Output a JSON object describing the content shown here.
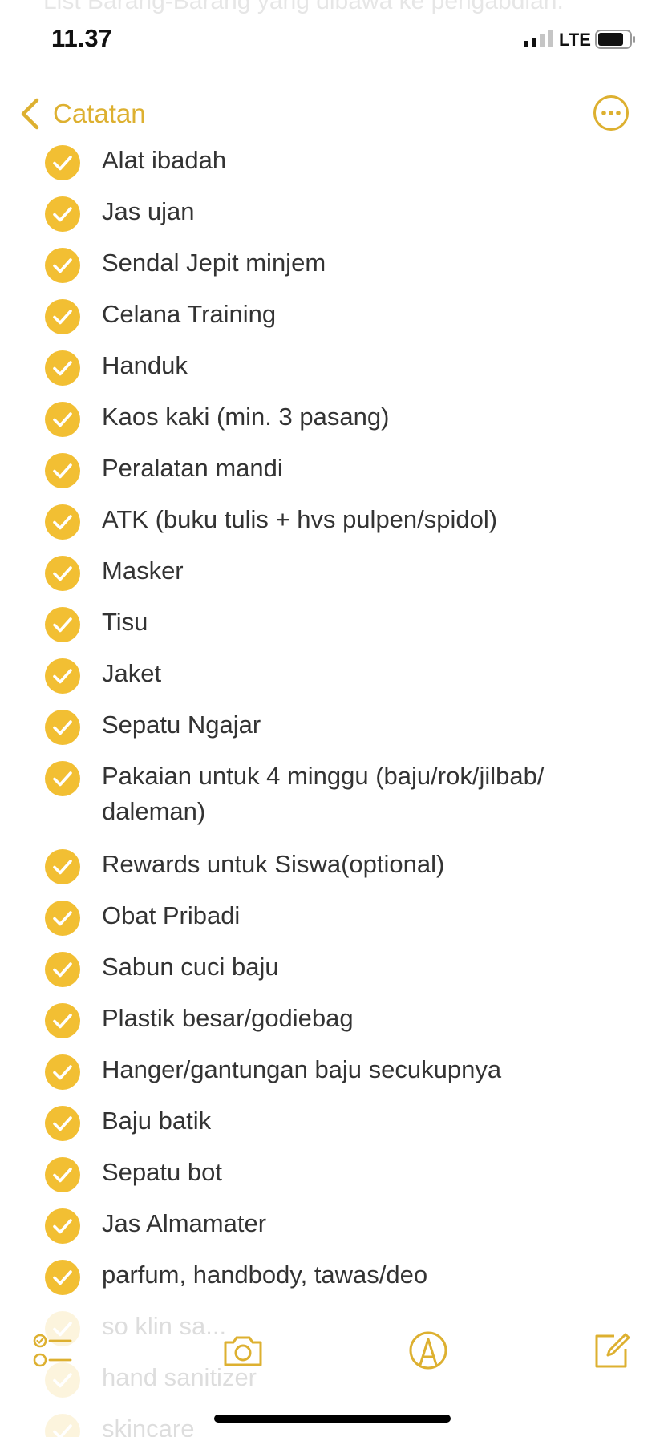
{
  "status_bar": {
    "time": "11.37",
    "network": "LTE"
  },
  "note_header": {
    "ghost_title": "List Barang-Barang yang dibawa ke pengabdian."
  },
  "nav": {
    "back_label": "Catatan"
  },
  "checklist": [
    {
      "text": "Alat ibadah"
    },
    {
      "text": "Jas ujan"
    },
    {
      "text": "Sendal Jepit minjem"
    },
    {
      "text": "Celana Training"
    },
    {
      "text": "Handuk"
    },
    {
      "text": "Kaos kaki (min. 3 pasang)"
    },
    {
      "text": "Peralatan mandi"
    },
    {
      "text": "ATK (buku tulis + hvs pulpen/spidol)"
    },
    {
      "text": "Masker"
    },
    {
      "text": "Tisu"
    },
    {
      "text": "Jaket"
    },
    {
      "text": "Sepatu Ngajar"
    },
    {
      "text": "Pakaian untuk 4 minggu (baju/rok/jilbab/ daleman)"
    },
    {
      "text": "Rewards untuk Siswa(optional)"
    },
    {
      "text": "Obat Pribadi"
    },
    {
      "text": "Sabun cuci baju"
    },
    {
      "text": "Plastik besar/godiebag"
    },
    {
      "text": "Hanger/gantungan baju secukupnya"
    },
    {
      "text": "Baju batik"
    },
    {
      "text": "Sepatu bot"
    },
    {
      "text": "Jas Almamater"
    },
    {
      "text": "parfum, handbody, tawas/deo"
    },
    {
      "text": "so klin sa..."
    },
    {
      "text": "hand sanitizer"
    },
    {
      "text": "skincare"
    }
  ],
  "toolbar": {
    "icons": [
      "checklist-icon",
      "camera-icon",
      "markup-icon",
      "compose-icon"
    ]
  },
  "colors": {
    "accent": "#e6b42c",
    "check": "#f2bf33",
    "text": "#333333"
  }
}
